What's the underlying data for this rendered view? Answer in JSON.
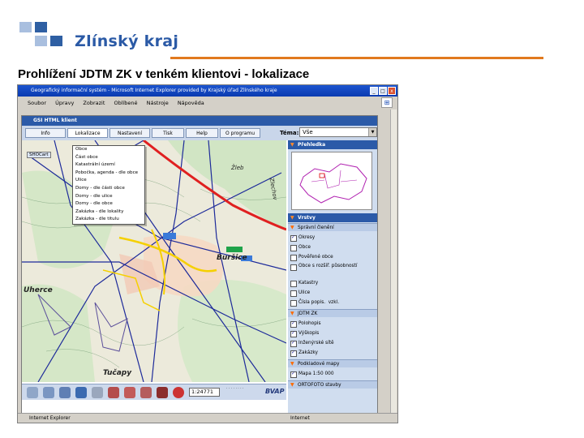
{
  "header": {
    "logo_text": "Zlínský kraj",
    "title": "Prohlížení JDTM ZK v tenkém klientovi - lokalizace",
    "accent": "#e1791e",
    "brand": "#2b5aa6"
  },
  "window": {
    "title": "Geografický informační systém - Microsoft Internet Explorer provided by Krajský úřad Zlínského kraje",
    "menu": [
      "Soubor",
      "Úpravy",
      "Zobrazit",
      "Oblíbené",
      "Nástroje",
      "Nápověda"
    ],
    "status_left": "Internet Explorer",
    "status_right": "Internet"
  },
  "app": {
    "header": "GSI HTML klient",
    "tabs": [
      "Info",
      "Lokalizace",
      "Nastavení",
      "Tisk",
      "Help",
      "O programu"
    ],
    "active_tab": "Lokalizace",
    "tema_label": "Téma:",
    "tema_value": "Vše",
    "lokalizace_menu": [
      "Obce",
      "Část obce",
      "Katastrální území",
      "Pobočka, agenda - dle obce",
      "Ulice",
      "Domy - dle části obce",
      "Domy - dle ulice",
      "Domy - dle obce",
      "Zakázka - dle lokality",
      "Zakázka - dle titulu"
    ],
    "map_labels": [
      "Žleb",
      "Zlechov",
      "Buršice",
      "Tučapy",
      "Uherce"
    ],
    "overview_tag": "SHOCart",
    "scale_value": "1:24771",
    "logo_bvap": "BVAP"
  },
  "panel": {
    "prehledka": "Přehledka",
    "vrstvy": "Vrstvy",
    "spravni_cleneni": "Správní členění",
    "layers": [
      {
        "label": "Okresy",
        "checked": true
      },
      {
        "label": "Obce",
        "checked": false
      },
      {
        "label": "Pověřené obce",
        "checked": false
      },
      {
        "label": "Obce s rozšíř. působností",
        "checked": false
      },
      {
        "label": "Katastry",
        "checked": false
      },
      {
        "label": "Ulice",
        "checked": false
      },
      {
        "label": "Čísla popis.  vzkl.",
        "checked": false
      }
    ],
    "jdtm_header": "JDTM ZK",
    "jdtm_layers": [
      {
        "label": "Polohopis",
        "checked": true
      },
      {
        "label": "Výškopis",
        "checked": true
      },
      {
        "label": "Inženýrské sítě",
        "checked": true
      },
      {
        "label": "Zakázky",
        "checked": true
      }
    ],
    "podklad_header": "Podkladové mapy",
    "podklad_layers": [
      {
        "label": "Mapa 1:50 000",
        "checked": true
      }
    ],
    "ortofoto_header": "ORTOFOTO stavby"
  }
}
